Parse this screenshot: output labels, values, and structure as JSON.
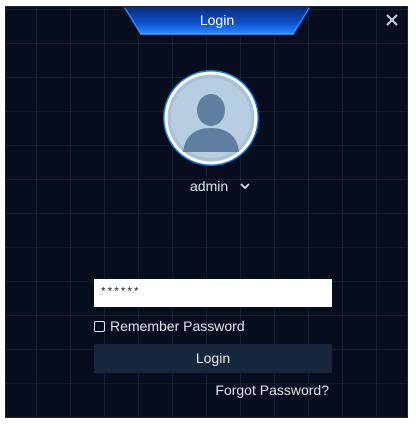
{
  "dialog": {
    "title": "Login",
    "close_icon": "close-icon"
  },
  "user": {
    "avatar_icon": "user-avatar-icon",
    "selected_user": "admin",
    "dropdown_icon": "chevron-down-icon"
  },
  "password": {
    "value": "******"
  },
  "remember": {
    "label": "Remember Password",
    "checked": false
  },
  "login_button": {
    "label": "Login"
  },
  "forgot_link": {
    "label": "Forgot Password?"
  },
  "colors": {
    "background": "#070d1c",
    "title_accent": "#1e7bff",
    "avatar_blue": "#1976d6",
    "button": "#17263c"
  }
}
